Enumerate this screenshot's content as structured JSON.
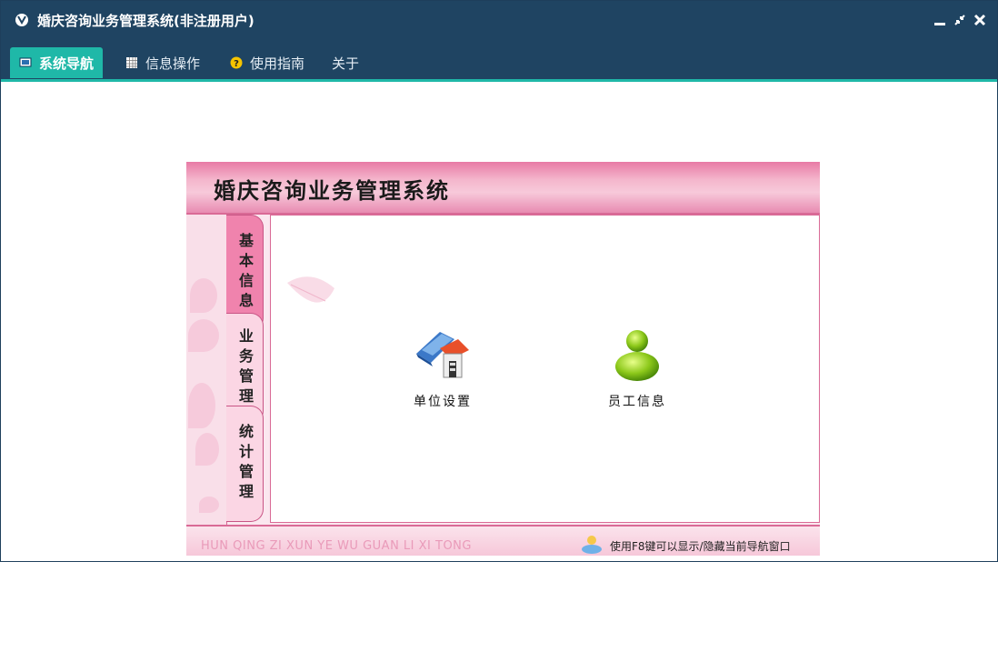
{
  "window": {
    "title": "婚庆咨询业务管理系统(非注册用户)"
  },
  "menu": {
    "tabs": [
      {
        "label": "系统导航",
        "icon": "monitor-icon",
        "active": true
      },
      {
        "label": "信息操作",
        "icon": "grid-icon",
        "active": false
      },
      {
        "label": "使用指南",
        "icon": "help-icon",
        "active": false
      },
      {
        "label": "关于",
        "icon": "",
        "active": false
      }
    ]
  },
  "panel": {
    "title": "婚庆咨询业务管理系统",
    "side_tabs": [
      {
        "label": "基本信息",
        "active": true
      },
      {
        "label": "业务管理",
        "active": false
      },
      {
        "label": "统计管理",
        "active": false
      }
    ],
    "items": [
      {
        "label": "单位设置",
        "icon": "building-icon"
      },
      {
        "label": "员工信息",
        "icon": "user-icon"
      }
    ],
    "footer": {
      "pinyin": "HUN QING ZI XUN YE WU GUAN LI XI TONG",
      "hint": "使用F8键可以显示/隐藏当前导航窗口"
    }
  },
  "colors": {
    "titlebar": "#1f4462",
    "accent": "#1fb8a8",
    "pink": "#f083ad"
  }
}
